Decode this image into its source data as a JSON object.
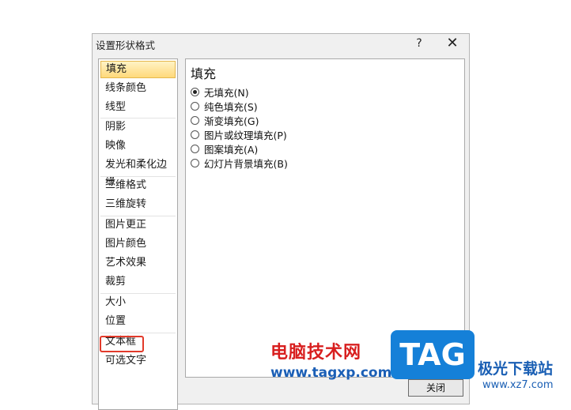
{
  "dialog": {
    "title": "设置形状格式",
    "help_label": "?",
    "close_label": "✕"
  },
  "nav": {
    "items": [
      {
        "label": "填充",
        "selected": true
      },
      {
        "label": "线条颜色"
      },
      {
        "label": "线型"
      },
      {
        "label": "阴影"
      },
      {
        "label": "映像"
      },
      {
        "label": "发光和柔化边缘"
      },
      {
        "label": "三维格式"
      },
      {
        "label": "三维旋转"
      },
      {
        "label": "图片更正"
      },
      {
        "label": "图片颜色"
      },
      {
        "label": "艺术效果"
      },
      {
        "label": "裁剪"
      },
      {
        "label": "大小"
      },
      {
        "label": "位置"
      },
      {
        "label": "文本框"
      },
      {
        "label": "可选文字"
      }
    ]
  },
  "fill_panel": {
    "title": "填充",
    "options": [
      {
        "label": "无填充(N)",
        "checked": true
      },
      {
        "label": "纯色填充(S)",
        "checked": false
      },
      {
        "label": "渐变填充(G)",
        "checked": false
      },
      {
        "label": "图片或纹理填充(P)",
        "checked": false
      },
      {
        "label": "图案填充(A)",
        "checked": false
      },
      {
        "label": "幻灯片背景填充(B)",
        "checked": false
      }
    ]
  },
  "footer": {
    "close_button": "关闭"
  },
  "watermark": {
    "site_name": "电脑技术网",
    "site_url": "www.tagxp.com",
    "logo_text": "TAG",
    "logo_site": "极光下载站",
    "logo_url": "www.xz7.com",
    "highlight_color": "#e23a2a"
  }
}
